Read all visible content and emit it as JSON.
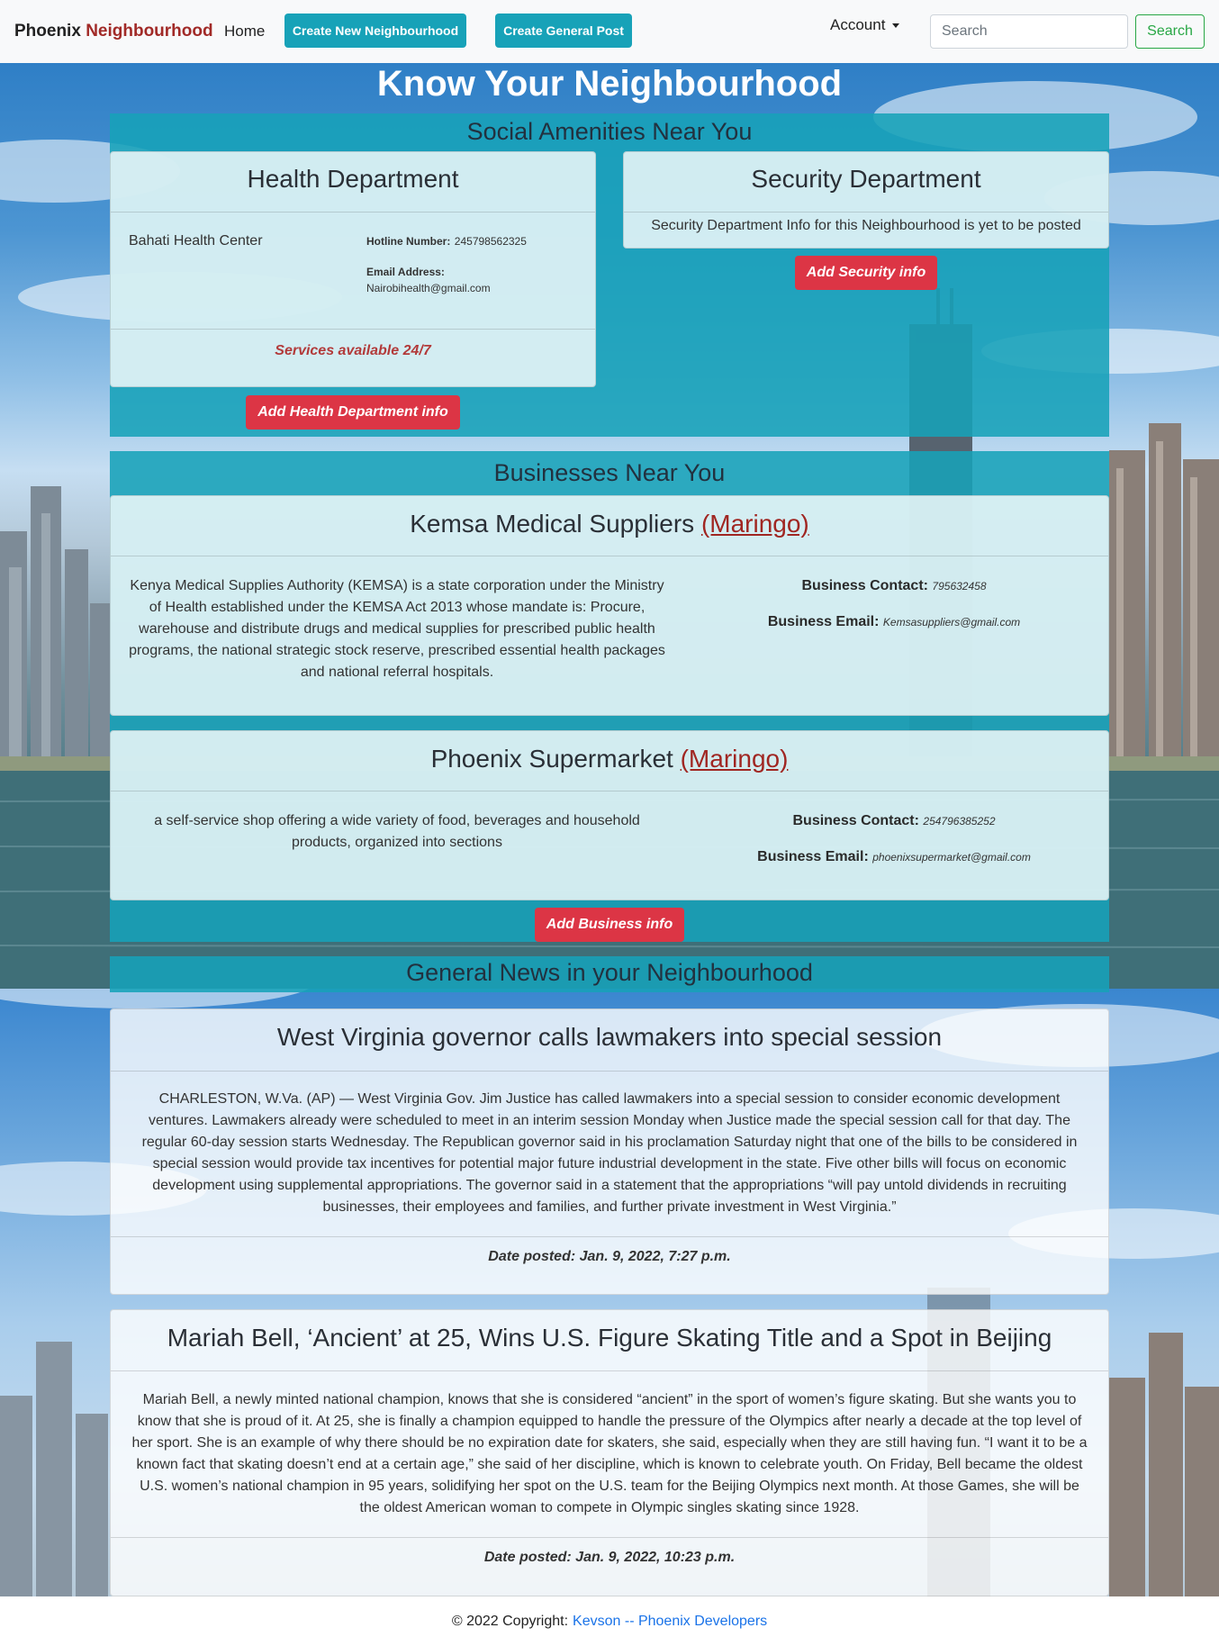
{
  "navbar": {
    "brand_main": "Phoenix",
    "brand_accent": "Neighbourhood",
    "home": "Home",
    "create_neighbourhood": "Create New Neighbourhood",
    "create_post": "Create General Post",
    "account": "Account",
    "search_placeholder": "Search",
    "search_button": "Search"
  },
  "page_title": "Know Your Neighbourhood",
  "amenities": {
    "title": "Social Amenities Near You",
    "health": {
      "title": "Health Department",
      "name": "Bahati Health Center",
      "hotline_label": "Hotline Number:",
      "hotline": "245798562325",
      "email_label": "Email Address:",
      "email": "Nairobihealth@gmail.com",
      "services": "Services available 24/7",
      "add_button": "Add Health Department info"
    },
    "security": {
      "title": "Security Department",
      "message": "Security Department Info for this Neighbourhood is yet to be posted",
      "add_button": "Add Security info"
    }
  },
  "businesses": {
    "title": "Businesses Near You",
    "items": [
      {
        "name": "Kemsa Medical Suppliers",
        "location": "(Maringo)",
        "description": "Kenya Medical Supplies Authority (KEMSA) is a state corporation under the Ministry of Health established under the KEMSA Act 2013 whose mandate is: Procure, warehouse and distribute drugs and medical supplies for prescribed public health programs, the national strategic stock reserve, prescribed essential health packages and national referral hospitals.",
        "contact_label": "Business Contact:",
        "contact": "795632458",
        "email_label": "Business Email:",
        "email": "Kemsasuppliers@gmail.com"
      },
      {
        "name": "Phoenix Supermarket",
        "location": "(Maringo)",
        "description": "a self-service shop offering a wide variety of food, beverages and household products, organized into sections",
        "contact_label": "Business Contact:",
        "contact": "254796385252",
        "email_label": "Business Email:",
        "email": "phoenixsupermarket@gmail.com"
      }
    ],
    "add_button": "Add Business info"
  },
  "news": {
    "title": "General News in your Neighbourhood",
    "items": [
      {
        "headline": "West Virginia governor calls lawmakers into special session",
        "body": "CHARLESTON, W.Va. (AP) — West Virginia Gov. Jim Justice has called lawmakers into a special session to consider economic development ventures. Lawmakers already were scheduled to meet in an interim session Monday when Justice made the special session call for that day. The regular 60-day session starts Wednesday. The Republican governor said in his proclamation Saturday night that one of the bills to be considered in special session would provide tax incentives for potential major future industrial development in the state. Five other bills will focus on economic development using supplemental appropriations. The governor said in a statement that the appropriations “will pay untold dividends in recruiting businesses, their employees and families, and further private investment in West Virginia.”",
        "date": "Date posted: Jan. 9, 2022, 7:27 p.m."
      },
      {
        "headline": "Mariah Bell, ‘Ancient’ at 25, Wins U.S. Figure Skating Title and a Spot in Beijing",
        "body": "Mariah Bell, a newly minted national champion, knows that she is considered “ancient” in the sport of women’s figure skating. But she wants you to know that she is proud of it. At 25, she is finally a champion equipped to handle the pressure of the Olympics after nearly a decade at the top level of her sport. She is an example of why there should be no expiration date for skaters, she said, especially when they are still having fun. “I want it to be a known fact that skating doesn’t end at a certain age,” she said of her discipline, which is known to celebrate youth. On Friday, Bell became the oldest U.S. women’s national champion in 95 years, solidifying her spot on the U.S. team for the Beijing Olympics next month. At those Games, she will be the oldest American woman to compete in Olympic singles skating since 1928.",
        "date": "Date posted: Jan. 9, 2022, 10:23 p.m."
      }
    ]
  },
  "footer": {
    "copyright": "© 2022 Copyright:",
    "link": "Kevson -- Phoenix Developers"
  }
}
